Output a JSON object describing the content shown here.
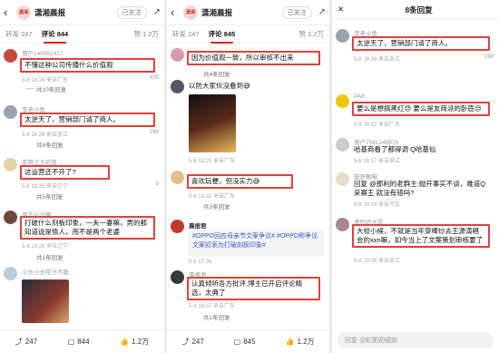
{
  "panel1": {
    "account": "潇湘晨报",
    "follow": "已关注",
    "tabs": {
      "repost": "转发 247",
      "comments": "评论 844",
      "likes": "赞 1.2万"
    },
    "comments": [
      {
        "user": "用户14005241?",
        "text": "不懂这种公司传播什么价值观",
        "meta": "5-8 18:28 来自广东",
        "like": "435",
        "more": "共10条回复"
      },
      {
        "user": "李老小鱼",
        "text": "太逆天了，营销部门请了商人。",
        "meta": "5-8 18:26 来自浙江",
        "like": "289",
        "more": "共8条回复"
      },
      {
        "user": "亚特兰大的鱼",
        "text": "这运营还不开了?",
        "meta": "5-8 18:35 来自辽宁",
        "like": "9",
        "more": "共5条回复"
      },
      {
        "user": "南方以北啊",
        "text": "打破什么刻板印象，一夫一妻嘛，男的都知道说是情人，而不是两个老婆",
        "meta": "5-8 19:28 来自辽宁",
        "like": "",
        "more": "共1条回复"
      },
      {
        "user": "小头小头吃汁不散",
        "text": "",
        "meta": "",
        "like": "",
        "more": ""
      }
    ],
    "bottom": {
      "repost": "247",
      "comment": "844",
      "like": "1.2万"
    }
  },
  "panel2": {
    "account": "潇湘晨报",
    "follow": "已关注",
    "tabs": {
      "repost": "转发 247",
      "comments": "评论 845",
      "likes": "赞 1.2万"
    },
    "comments": [
      {
        "user": "",
        "text": "因为价值观一致，所以审核不出来",
        "meta": "5-8 18:25 来自广东",
        "like": "",
        "more": "共4条回复"
      },
      {
        "user": "",
        "text": "以防大家伙没看到😅",
        "meta": "5-8 19:25 来自广东",
        "like": "",
        "more": ""
      },
      {
        "user": "",
        "text": "喜欢玩梗，但没实力😅",
        "meta": "5-8 18:32 来自广东",
        "like": "",
        "more": "共3条回复"
      },
      {
        "user": "晨报君",
        "text": "#OPPO回应母亲节文案争议# #OPPO称争议文案初衷为打破刻板印象#",
        "meta": "5-8 17:36",
        "like": "",
        "more": "共5条回复"
      },
      {
        "user": "晨报君",
        "text": "认真倾听各方批评,博主已开启评论精选，太典了",
        "meta": "5-8 18:07 来自广东",
        "like": "",
        "more": "共1条回复"
      }
    ],
    "bottom": {
      "repost": "247",
      "comment": "845",
      "like": "1.2万"
    }
  },
  "panel3": {
    "title": "8条回复",
    "comments": [
      {
        "user": "李老小鱼",
        "text": "太逆天了，营销部门请了商人。",
        "meta": "5-8 18:26 来自浙江",
        "like": "289"
      },
      {
        "user": "PAE",
        "text": "要么是想搞黑红😓 要么是友商派的卧底😒",
        "meta": "5-8 18:52 来自广东",
        "like": ""
      },
      {
        "user": "用户7581248870",
        "text": "哈基商看了都得调 Q哈基仙",
        "meta": "5-8 19:17 来自浙江",
        "like": ""
      },
      {
        "user": "鼓舒飘喵",
        "text": "回复 @那利的老群主:抛开事实不谈，难道Q 采赛王 就没有错吗?",
        "meta": "5-8 19:19 来自河北",
        "like": ""
      },
      {
        "user": "虚竹的大哥",
        "text": "大校小候，不就是当年穿棒炒去王源演唱会的xxn嘛，如今当上了文案策划审核要了",
        "meta": "5-8 19:25 来自浙江",
        "like": ""
      }
    ],
    "footer": "回复 @虻肥初疑就"
  }
}
